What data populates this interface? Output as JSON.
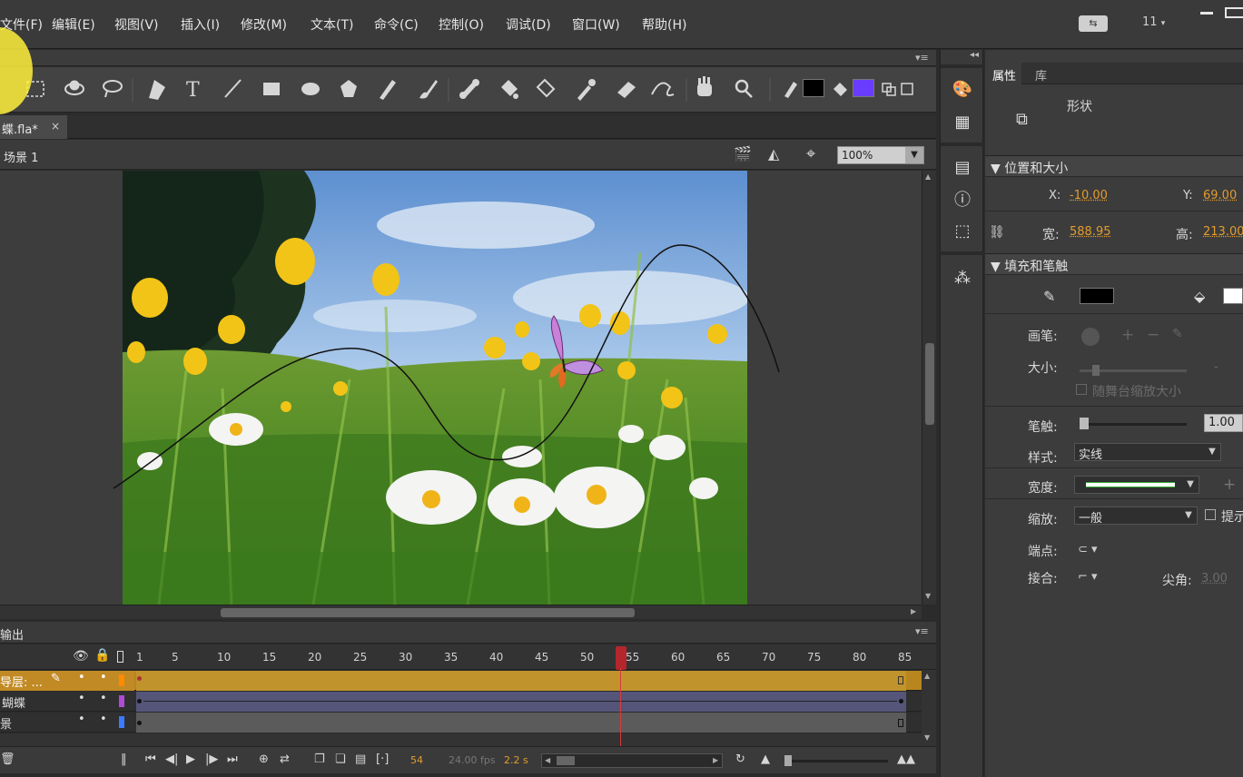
{
  "menu": [
    "文件(F)",
    "编辑(E)",
    "视图(V)",
    "插入(I)",
    "修改(M)",
    "文本(T)",
    "命令(C)",
    "控制(O)",
    "调试(D)",
    "窗口(W)",
    "帮助(H)"
  ],
  "workspace": {
    "number": "11",
    "number_caret": "▾"
  },
  "tools": [
    "selection-icon",
    "free-transform-icon",
    "3d-rotation-icon",
    "lasso-icon",
    "pen-icon",
    "text-icon",
    "line-icon",
    "rectangle-icon",
    "oval-icon",
    "polystar-icon",
    "pencil-icon",
    "brush-icon",
    "bone-icon",
    "paint-bucket-icon",
    "ink-bottle-icon",
    "eyedropper-icon",
    "eraser-icon",
    "width-icon",
    "hand-icon",
    "zoom-icon"
  ],
  "colors": {
    "stroke": "#000000",
    "fill": "#6a3cff",
    "accent": "#e39c2d",
    "guide_layer": "#c28a24",
    "butterfly_layer": "#55557a"
  },
  "document": {
    "tab_label": "蝶.fla*",
    "close": "×"
  },
  "scene": {
    "label": "场景 1",
    "zoom": "100%"
  },
  "timeline": {
    "tab_label": "输出",
    "ticks": [
      "1",
      "5",
      "10",
      "15",
      "20",
      "25",
      "30",
      "35",
      "40",
      "45",
      "50",
      "55",
      "60",
      "65",
      "70",
      "75",
      "80",
      "85"
    ],
    "layers": [
      {
        "name": "导层: ...",
        "color": "#ff8a00"
      },
      {
        "name": "蝴蝶",
        "color": "#b04ad8"
      },
      {
        "name": "景",
        "color": "#3a7bff"
      }
    ],
    "current_frame": "54",
    "fps": "24.00 fps",
    "time": "2.2 s"
  },
  "properties": {
    "tabs": [
      "属性",
      "库"
    ],
    "type_label": "形状",
    "section_pos": "位置和大小",
    "x_label": "X:",
    "x_val": "-10.00",
    "y_label": "Y:",
    "y_val": "69.00",
    "w_label": "宽:",
    "w_val": "588.95",
    "h_label": "高:",
    "h_val": "213.00",
    "section_fill": "填充和笔触",
    "brush_label": "画笔:",
    "size_label": "大小:",
    "scale_check": "随舞台缩放大小",
    "stroke_label": "笔触:",
    "stroke_val": "1.00",
    "style_label": "样式:",
    "style_val": "实线",
    "width_label": "宽度:",
    "scale_label": "缩放:",
    "scale_val": "一般",
    "hint_label": "提示",
    "cap_label": "端点:",
    "join_label": "接合:",
    "miter_label": "尖角:",
    "miter_val": "3.00"
  }
}
